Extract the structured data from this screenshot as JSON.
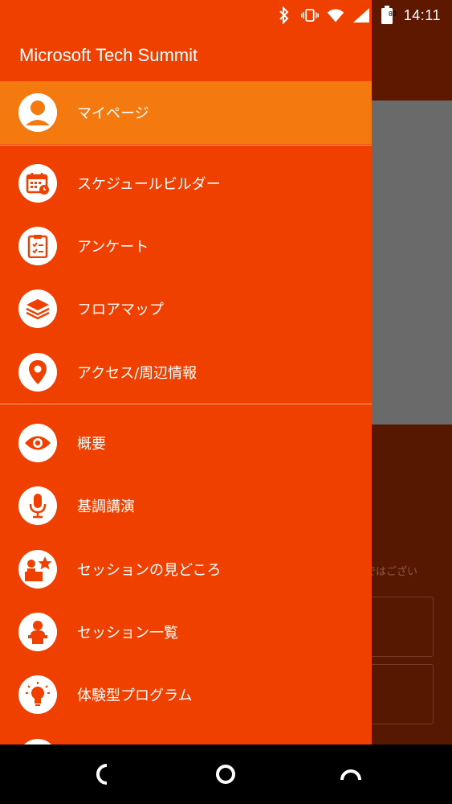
{
  "status_bar": {
    "battery_level": "80",
    "time": "14:11",
    "icons": [
      "bluetooth-icon",
      "vibrate-icon",
      "wifi-icon",
      "signal-icon",
      "battery-icon"
    ]
  },
  "drawer": {
    "title": "Microsoft Tech Summit",
    "items": [
      {
        "label": "マイページ",
        "icon": "user-icon",
        "active": true
      },
      {
        "label": "スケジュールビルダー",
        "icon": "calendar-icon"
      },
      {
        "label": "アンケート",
        "icon": "clipboard-icon"
      },
      {
        "label": "フロアマップ",
        "icon": "layers-icon"
      },
      {
        "label": "アクセス/周辺情報",
        "icon": "location-pin-icon"
      },
      {
        "label": "概要",
        "icon": "eye-icon"
      },
      {
        "label": "基調講演",
        "icon": "microphone-icon"
      },
      {
        "label": "セッションの見どころ",
        "icon": "star-speaker-icon"
      },
      {
        "label": "セッション一覧",
        "icon": "speaker-podium-icon"
      },
      {
        "label": "体験型プログラム",
        "icon": "lightbulb-icon"
      }
    ]
  },
  "background": {
    "partial_text": "ではござい"
  },
  "colors": {
    "drawer_bg": "#f04000",
    "active_bg": "#f47a10",
    "overlay_dark": "#5a1a00"
  },
  "nav_bar": {
    "buttons": [
      "back-icon",
      "home-icon",
      "recents-icon"
    ]
  }
}
